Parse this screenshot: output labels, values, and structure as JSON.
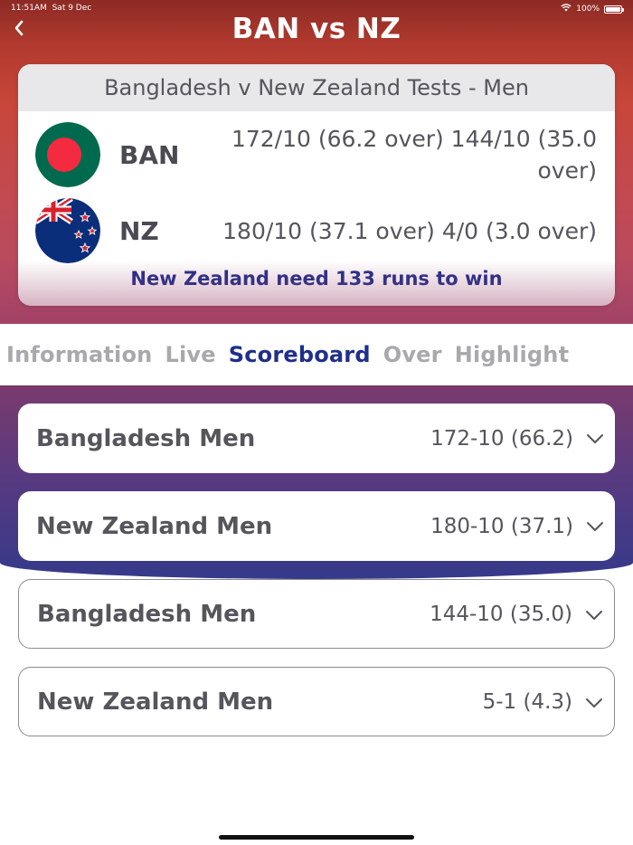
{
  "status_bar": {
    "time": "11:51AM",
    "date": "Sat 9 Dec",
    "battery": "100%"
  },
  "header": {
    "title": "BAN vs NZ",
    "back_icon": "chevron-left-icon"
  },
  "match": {
    "competition": "Bangladesh v New Zealand Tests - Men",
    "teams": [
      {
        "code": "BAN",
        "score": "172/10 (66.2 over) 144/10 (35.0 over)",
        "flag": "bangladesh-flag-icon"
      },
      {
        "code": "NZ",
        "score": "180/10 (37.1 over) 4/0 (3.0 over)",
        "flag": "new-zealand-flag-icon"
      }
    ],
    "result": "New Zealand need 133 runs to win"
  },
  "tabs": [
    {
      "label": "Information",
      "active": false
    },
    {
      "label": "Live",
      "active": false
    },
    {
      "label": "Scoreboard",
      "active": true
    },
    {
      "label": "Over",
      "active": false
    },
    {
      "label": "Highlight",
      "active": false
    }
  ],
  "innings": [
    {
      "team": "Bangladesh Men",
      "score": "172-10 (66.2)"
    },
    {
      "team": "New Zealand Men",
      "score": "180-10 (37.1)"
    },
    {
      "team": "Bangladesh Men",
      "score": "144-10 (35.0)"
    },
    {
      "team": "New Zealand Men",
      "score": "5-1 (4.3)"
    }
  ],
  "colors": {
    "accent": "#1f2f8c",
    "header_red": "#c8463a",
    "tab_inactive": "#a8a8ad"
  }
}
